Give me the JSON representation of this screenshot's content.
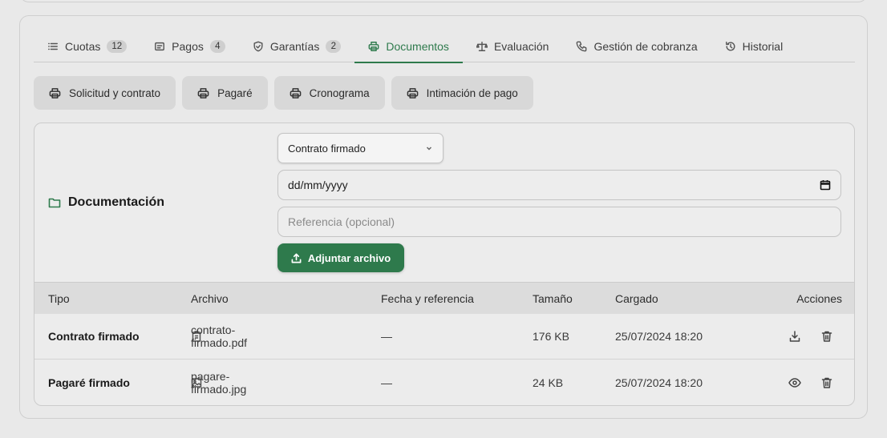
{
  "tabs": [
    {
      "label": "Cuotas",
      "badge": "12",
      "icon": "list-icon"
    },
    {
      "label": "Pagos",
      "badge": "4",
      "icon": "receipt-icon"
    },
    {
      "label": "Garantías",
      "badge": "2",
      "icon": "shield-icon"
    },
    {
      "label": "Documentos",
      "icon": "printer-icon",
      "active": true
    },
    {
      "label": "Evaluación",
      "icon": "scale-icon"
    },
    {
      "label": "Gestión de cobranza",
      "icon": "phone-icon"
    },
    {
      "label": "Historial",
      "icon": "history-icon"
    }
  ],
  "print_buttons": [
    "Solicitud y contrato",
    "Pagaré",
    "Cronograma",
    "Intimación de pago"
  ],
  "documentation": {
    "title": "Documentación",
    "type_select": "Contrato firmado",
    "date_placeholder": "dd/mm/yyyy",
    "reference_placeholder": "Referencia (opcional)",
    "upload_label": "Adjuntar archivo"
  },
  "table": {
    "headers": {
      "tipo": "Tipo",
      "archivo": "Archivo",
      "fecha": "Fecha y referencia",
      "tamano": "Tamaño",
      "cargado": "Cargado",
      "acciones": "Acciones"
    },
    "rows": [
      {
        "tipo": "Contrato firmado",
        "archivo": "contrato-firmado.pdf",
        "fecha": "—",
        "tamano": "176 KB",
        "cargado": "25/07/2024 18:20",
        "file_icon": "document-icon",
        "actions": [
          "download-icon",
          "trash-icon"
        ]
      },
      {
        "tipo": "Pagaré firmado",
        "archivo": "pagare-firmado.jpg",
        "fecha": "—",
        "tamano": "24 KB",
        "cargado": "25/07/2024 18:20",
        "file_icon": "image-icon",
        "actions": [
          "eye-icon",
          "trash-icon"
        ]
      }
    ]
  },
  "colors": {
    "accent": "#2e7a4c",
    "background": "#e9e9e9"
  }
}
